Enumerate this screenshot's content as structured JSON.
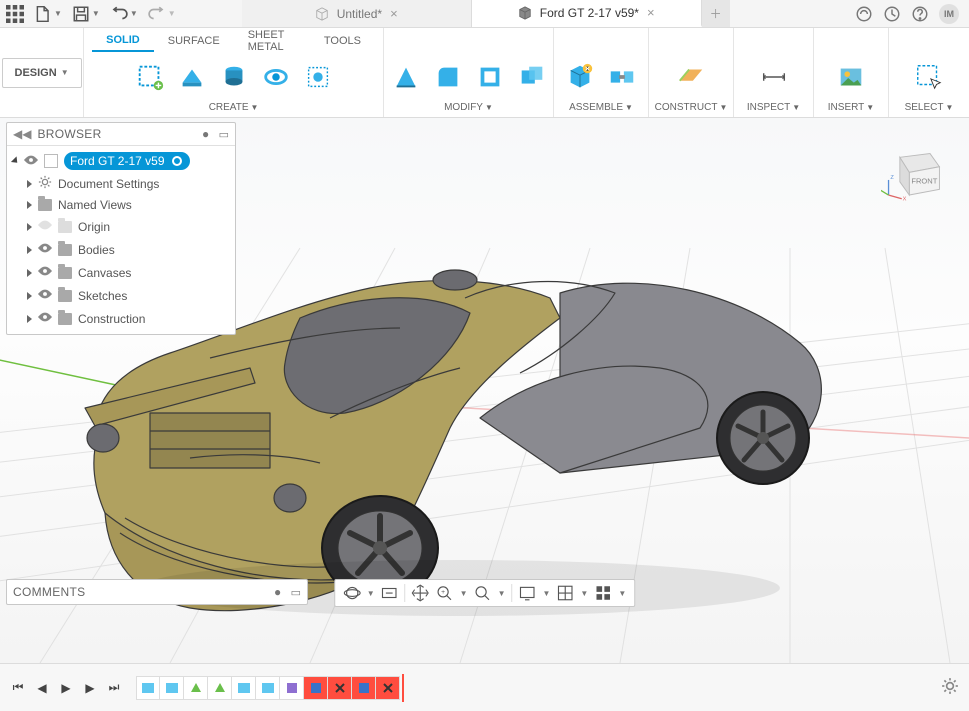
{
  "topbar": {
    "tabs": [
      {
        "label": "Untitled*",
        "active": false
      },
      {
        "label": "Ford GT 2-17 v59*",
        "active": true
      }
    ],
    "avatar_initials": "IM"
  },
  "ribbon": {
    "mode_label": "DESIGN",
    "sub_tabs": [
      "SOLID",
      "SURFACE",
      "SHEET METAL",
      "TOOLS"
    ],
    "active_sub_tab": "SOLID",
    "groups": {
      "create": "CREATE",
      "modify": "MODIFY",
      "assemble": "ASSEMBLE",
      "construct": "CONSTRUCT",
      "inspect": "INSPECT",
      "insert": "INSERT",
      "select": "SELECT"
    }
  },
  "browser": {
    "title": "BROWSER",
    "root_label": "Ford GT 2-17 v59",
    "nodes": [
      {
        "label": "Document Settings",
        "icon": "gear"
      },
      {
        "label": "Named Views",
        "icon": "folder"
      },
      {
        "label": "Origin",
        "icon": "ghost-folder",
        "eye": "ghost"
      },
      {
        "label": "Bodies",
        "icon": "folder",
        "eye": "solid"
      },
      {
        "label": "Canvases",
        "icon": "folder",
        "eye": "solid"
      },
      {
        "label": "Sketches",
        "icon": "folder",
        "eye": "solid"
      },
      {
        "label": "Construction",
        "icon": "folder",
        "eye": "solid"
      }
    ]
  },
  "viewcube": {
    "face": "FRONT"
  },
  "comments": {
    "title": "COMMENTS"
  },
  "view_toolbar_icons": [
    "orbit",
    "lookat",
    "pan",
    "zoom",
    "fit",
    "display",
    "grid",
    "viewports"
  ],
  "timeline": {
    "items": [
      {
        "kind": "sketch"
      },
      {
        "kind": "sketch"
      },
      {
        "kind": "form"
      },
      {
        "kind": "form"
      },
      {
        "kind": "sketch"
      },
      {
        "kind": "sketch"
      },
      {
        "kind": "solid"
      },
      {
        "kind": "red-cut"
      },
      {
        "kind": "red-cut"
      },
      {
        "kind": "red-solid"
      },
      {
        "kind": "red-cut"
      }
    ]
  }
}
